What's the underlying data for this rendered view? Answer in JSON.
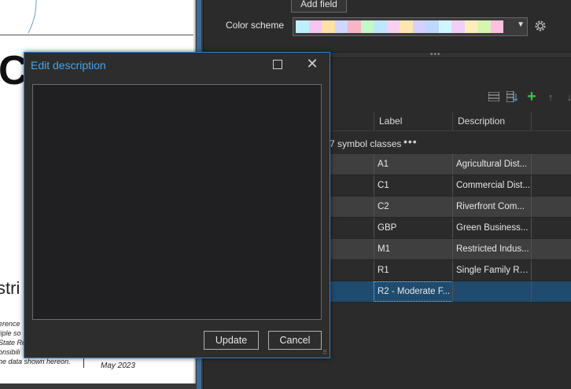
{
  "map": {
    "big_letter": "C",
    "fragment": "stri",
    "fine_print": [
      "erence",
      "tiple so",
      "State Re",
      "onsibili",
      "he data shown hereon."
    ],
    "date": "May 2023"
  },
  "symbology": {
    "add_field_label": "Add field",
    "color_scheme_label": "Color scheme",
    "color_scheme_swatches": [
      "#bfefff",
      "#f6c6f0",
      "#ffe0a6",
      "#cfd6ff",
      "#f7b6c6",
      "#c6f7c6",
      "#bfe6ff",
      "#f8d0f0",
      "#ffe6b0",
      "#d6d0ff",
      "#bfd8ff",
      "#d0f7ff",
      "#f0d0f8",
      "#ffeebb",
      "#d6f6b0",
      "#ffbfe0"
    ],
    "columns": {
      "label": "Label",
      "description": "Description"
    },
    "group_text": "7 symbol classes",
    "group_more": "•••",
    "rows": [
      {
        "label": "A1",
        "description": "Agricultural Dist..."
      },
      {
        "label": "C1",
        "description": "Commercial Dist..."
      },
      {
        "label": "C2",
        "description": "Riverfront Com..."
      },
      {
        "label": "GBP",
        "description": "Green Business..."
      },
      {
        "label": "M1",
        "description": "Restricted Indus..."
      },
      {
        "label": "R1",
        "description": "Single Family Re..."
      },
      {
        "label": "R2 - Moderate F...",
        "description": ""
      }
    ]
  },
  "dialog": {
    "title": "Edit description",
    "description_value": "",
    "update_label": "Update",
    "cancel_label": "Cancel"
  },
  "colors": {
    "accent": "#4aa3e8",
    "selected_row": "#1e4b6e",
    "add_icon": "#3fbf4a"
  }
}
